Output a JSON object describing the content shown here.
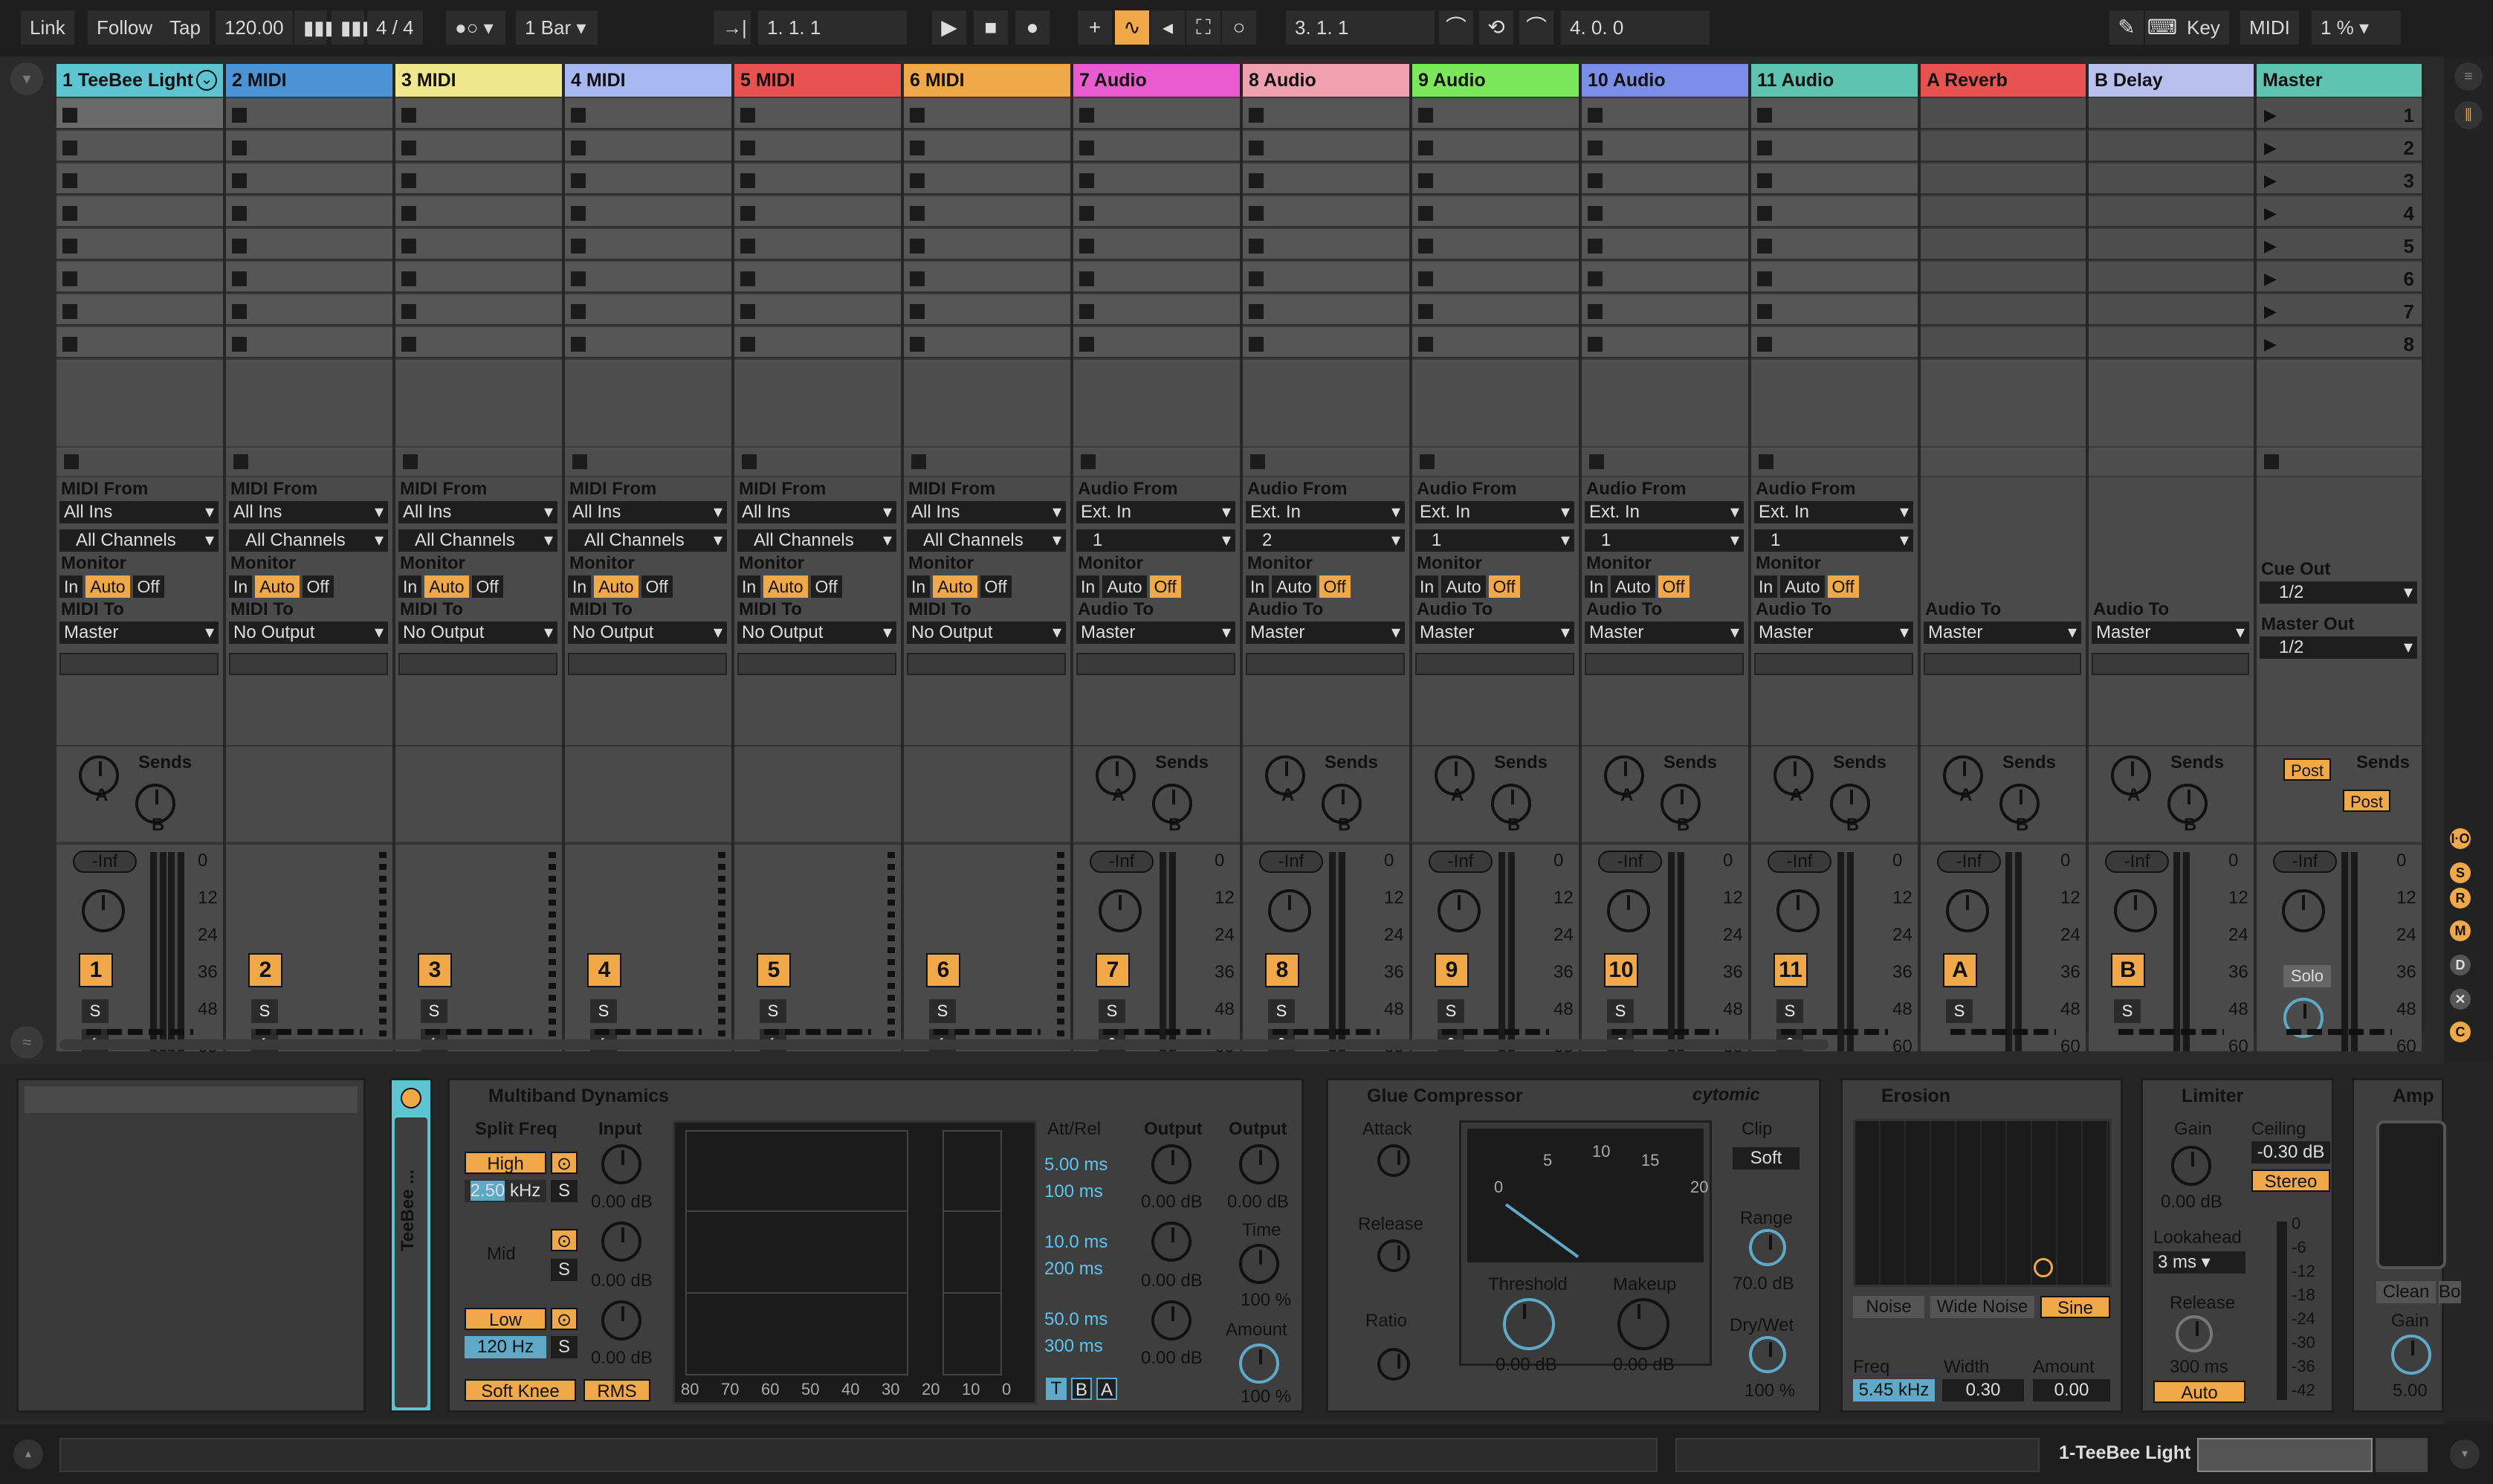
{
  "transport": {
    "link": "Link",
    "follow": "Follow",
    "tap": "Tap",
    "tempo": "120.00",
    "signature": "4 / 4",
    "quantize": "1 Bar",
    "position": "1.  1.  1",
    "loop_start": "3.  1.  1",
    "loop_length": "4.  0.  0",
    "key": "Key",
    "midi": "MIDI",
    "cpu": "1 %"
  },
  "tracks": [
    {
      "name": "1 TeeBee Light",
      "color": "#5ec4d2",
      "type": "midi",
      "num": "1",
      "from": "All Ins",
      "ch": "All Channels",
      "to": "Master"
    },
    {
      "name": "2 MIDI",
      "color": "#4b93d4",
      "type": "midi",
      "num": "2",
      "from": "All Ins",
      "ch": "All Channels",
      "to": "No Output"
    },
    {
      "name": "3 MIDI",
      "color": "#f0e68c",
      "type": "midi",
      "num": "3",
      "from": "All Ins",
      "ch": "All Channels",
      "to": "No Output"
    },
    {
      "name": "4 MIDI",
      "color": "#a7b8f0",
      "type": "midi",
      "num": "4",
      "from": "All Ins",
      "ch": "All Channels",
      "to": "No Output"
    },
    {
      "name": "5 MIDI",
      "color": "#e8524f",
      "type": "midi",
      "num": "5",
      "from": "All Ins",
      "ch": "All Channels",
      "to": "No Output"
    },
    {
      "name": "6 MIDI",
      "color": "#f0a848",
      "type": "midi",
      "num": "6",
      "from": "All Ins",
      "ch": "All Channels",
      "to": "No Output"
    },
    {
      "name": "7 Audio",
      "color": "#e85ccf",
      "type": "audio",
      "num": "7",
      "from": "Ext. In",
      "ch": "1",
      "to": "Master"
    },
    {
      "name": "8 Audio",
      "color": "#f0a0b0",
      "type": "audio",
      "num": "8",
      "from": "Ext. In",
      "ch": "2",
      "to": "Master"
    },
    {
      "name": "9 Audio",
      "color": "#7be85a",
      "type": "audio",
      "num": "9",
      "from": "Ext. In",
      "ch": "1",
      "to": "Master"
    },
    {
      "name": "10 Audio",
      "color": "#7b8ee8",
      "type": "audio",
      "num": "10",
      "from": "Ext. In",
      "ch": "1",
      "to": "Master"
    },
    {
      "name": "11 Audio",
      "color": "#5ec4b0",
      "type": "audio",
      "num": "11",
      "from": "Ext. In",
      "ch": "1",
      "to": "Master"
    },
    {
      "name": "A Reverb",
      "color": "#e8524f",
      "type": "return",
      "num": "A",
      "to": "Master"
    },
    {
      "name": "B Delay",
      "color": "#b8c0f0",
      "type": "return",
      "num": "B",
      "to": "Master"
    },
    {
      "name": "Master",
      "color": "#5ec4b0",
      "type": "master"
    }
  ],
  "labels": {
    "midi_from": "MIDI From",
    "audio_from": "Audio From",
    "monitor": "Monitor",
    "midi_to": "MIDI To",
    "audio_to": "Audio To",
    "in": "In",
    "auto": "Auto",
    "off": "Off",
    "sends": "Sends",
    "send_a": "A",
    "send_b": "B",
    "s": "S",
    "inf": "-Inf",
    "cue_out": "Cue Out",
    "cue_val": "1/2",
    "master_out": "Master Out",
    "master_val": "1/2",
    "post": "Post",
    "solo": "Solo",
    "scale": [
      "0",
      "12",
      "24",
      "36",
      "48",
      "60"
    ],
    "scenes": [
      "1",
      "2",
      "3",
      "4",
      "5",
      "6",
      "7",
      "8"
    ]
  },
  "devices": {
    "rack_name": "TeeBee ...",
    "multiband": {
      "title": "Multiband Dynamics",
      "split_freq": "Split Freq",
      "input": "Input",
      "output": "Output",
      "output2": "Output",
      "high": "High",
      "high_freq": "2.50",
      "khz": "kHz",
      "mid": "Mid",
      "low": "Low",
      "low_freq": "120 Hz",
      "in_vals": [
        "0.00 dB",
        "0.00 dB",
        "0.00 dB"
      ],
      "out_vals": [
        "0.00 dB",
        "0.00 dB",
        "0.00 dB"
      ],
      "out2": "0.00 dB",
      "time": "Time",
      "time_val": "100 %",
      "amount": "Amount",
      "amount_val": "100 %",
      "attrel": "Att/Rel",
      "att_vals": [
        "5.00 ms",
        "100 ms",
        "10.0 ms",
        "200 ms",
        "50.0 ms",
        "300 ms"
      ],
      "axis": [
        "80",
        "70",
        "60",
        "50",
        "40",
        "30",
        "20",
        "10",
        "0"
      ],
      "soft_knee": "Soft Knee",
      "rms": "RMS",
      "t": "T",
      "b": "B",
      "a": "A"
    },
    "glue": {
      "title": "Glue Compressor",
      "brand": "cytomic",
      "attack": "Attack",
      "release": "Release",
      "ratio": "Ratio",
      "clip": "Clip",
      "soft": "Soft",
      "range": "Range",
      "range_val": "70.0 dB",
      "drywet": "Dry/Wet",
      "drywet_val": "100 %",
      "threshold": "Threshold",
      "threshold_val": "0.00 dB",
      "makeup": "Makeup",
      "makeup_val": "0.00 dB",
      "vu": [
        "0",
        "5",
        "10",
        "15",
        "20"
      ]
    },
    "erosion": {
      "title": "Erosion",
      "noise": "Noise",
      "wide_noise": "Wide Noise",
      "sine": "Sine",
      "freq": "Freq",
      "freq_val": "5.45 kHz",
      "width": "Width",
      "width_val": "0.30",
      "amount": "Amount",
      "amount_val": "0.00"
    },
    "limiter": {
      "title": "Limiter",
      "gain": "Gain",
      "gain_val": "0.00 dB",
      "ceiling": "Ceiling",
      "ceiling_val": "-0.30 dB",
      "stereo": "Stereo",
      "lookahead": "Lookahead",
      "lookahead_val": "3 ms",
      "release": "Release",
      "release_val": "300 ms",
      "auto": "Auto",
      "scale": [
        "0",
        "-6",
        "-12",
        "-18",
        "-24",
        "-30",
        "-36",
        "-42"
      ]
    },
    "amp": {
      "title": "Amp",
      "clean": "Clean",
      "boost": "Boo",
      "gain": "Gain",
      "gain_val": "5.00"
    }
  },
  "status": {
    "track": "1-TeeBee Light"
  }
}
